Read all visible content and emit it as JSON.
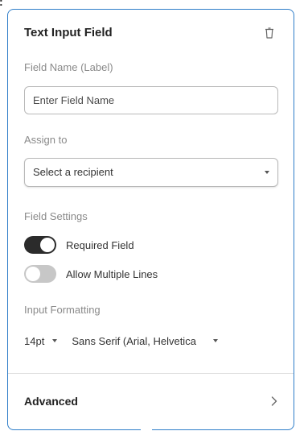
{
  "stray_text": ":",
  "panel": {
    "title": "Text Input Field",
    "icons": {
      "delete": "trash-icon"
    },
    "field_name": {
      "label": "Field Name (Label)",
      "placeholder": "Enter Field Name",
      "value": ""
    },
    "assign_to": {
      "label": "Assign to",
      "selected": "Select a recipient",
      "icon": "chevron-down-icon"
    },
    "field_settings": {
      "label": "Field Settings",
      "toggles": [
        {
          "label": "Required Field",
          "on": true
        },
        {
          "label": "Allow Multiple Lines",
          "on": false
        }
      ]
    },
    "input_formatting": {
      "label": "Input Formatting",
      "font_size": "14pt",
      "font_family": "Sans Serif (Arial, Helvetica"
    },
    "advanced": {
      "label": "Advanced",
      "icon": "chevron-right-icon"
    },
    "colors": {
      "border_accent": "#2f7ec9",
      "toggle_on": "#2b2b2b",
      "toggle_off": "#c7c7c7"
    }
  }
}
